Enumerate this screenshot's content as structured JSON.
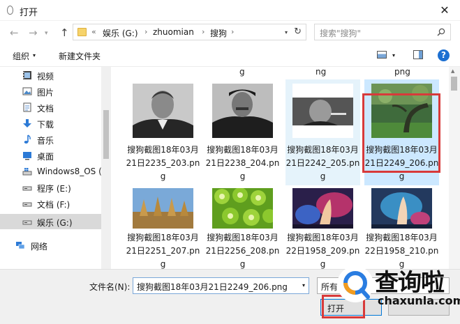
{
  "window": {
    "title": "打开",
    "close_glyph": "✕"
  },
  "nav": {
    "back_glyph": "←",
    "forward_glyph": "→",
    "recent_glyph": "▾",
    "up_glyph": "↑",
    "breadcrumb_prefix": "«",
    "breadcrumb": [
      "娱乐 (G:)",
      "zhuomian",
      "搜狗"
    ],
    "separator": "›",
    "dropdown_glyph": "▾",
    "refresh_glyph": "↻"
  },
  "search": {
    "placeholder": "搜索\"搜狗\""
  },
  "toolbar": {
    "organize_label": "组织",
    "organize_caret": "▾",
    "new_folder_label": "新建文件夹",
    "view_caret": "▾",
    "help_label": "?"
  },
  "sidebar": {
    "items": [
      {
        "label": "视频",
        "icon": "video-icon"
      },
      {
        "label": "图片",
        "icon": "pictures-icon"
      },
      {
        "label": "文档",
        "icon": "documents-icon"
      },
      {
        "label": "下载",
        "icon": "downloads-icon"
      },
      {
        "label": "音乐",
        "icon": "music-icon"
      },
      {
        "label": "桌面",
        "icon": "desktop-icon"
      },
      {
        "label": "Windows8_OS (",
        "icon": "drive-os-icon"
      },
      {
        "label": "程序 (E:)",
        "icon": "drive-icon"
      },
      {
        "label": "文档 (F:)",
        "icon": "drive-icon"
      },
      {
        "label": "娱乐 (G:)",
        "icon": "drive-icon",
        "selected": true
      },
      {
        "label": "网络",
        "icon": "network-icon"
      }
    ]
  },
  "files": {
    "column_fragments": [
      "g",
      "ng",
      "png"
    ],
    "row1": [
      {
        "name": "搜狗截图18年03月21日2235_203.png",
        "thumb": "portrait-man-bw"
      },
      {
        "name": "搜狗截图18年03月21日2238_204.png",
        "thumb": "portrait-uniform-bw"
      },
      {
        "name": "搜狗截图18年03月21日2242_205.png",
        "thumb": "portrait-cigar-bw",
        "state": "hover"
      },
      {
        "name": "搜狗截图18年03月21日2249_206.png",
        "thumb": "forest-tree",
        "state": "selected"
      }
    ],
    "row2": [
      {
        "name": "搜狗截图18年03月21日2251_207.png",
        "thumb": "haystacks"
      },
      {
        "name": "搜狗截图18年03月21日2256_208.png",
        "thumb": "kiwi-slices"
      },
      {
        "name": "搜狗截图18年03月22日1958_209.png",
        "thumb": "game-art-red"
      },
      {
        "name": "搜狗截图18年03月22日1958_210.png",
        "thumb": "game-art-blue"
      }
    ]
  },
  "bottom": {
    "filename_label": "文件名(N):",
    "filename_value": "搜狗截图18年03月21日2249_206.png",
    "filetype_value": "所有",
    "open_label": "打开",
    "caret_glyph": "▾"
  },
  "watermark": {
    "brand": "查询啦",
    "site": "chaxunla.com"
  },
  "colors": {
    "selection": "#cce8ff",
    "hover": "#e5f3fb",
    "highlight_box": "#d83a3a",
    "accent": "#0078d7"
  }
}
